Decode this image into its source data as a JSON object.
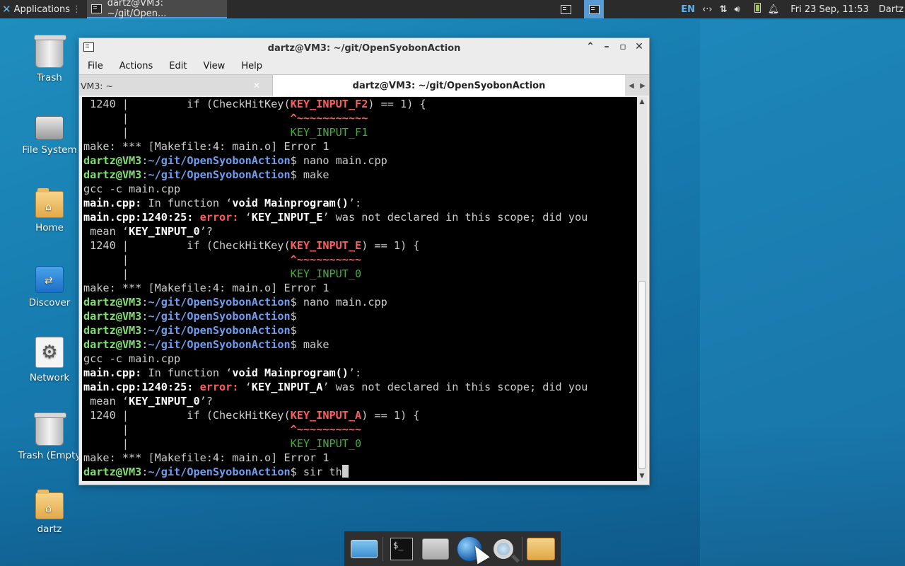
{
  "top_panel": {
    "applications_label": "Applications",
    "task_label": "dartz@VM3: ~/git/Open...",
    "keyboard_layout": "EN",
    "datetime": "Fri 23 Sep, 11:53",
    "user": "Dartz",
    "icons": [
      "network-icon",
      "transfer-icon",
      "volume-icon",
      "battery-icon",
      "bell-icon"
    ]
  },
  "desktop_icons": [
    {
      "label": "Trash",
      "icon": "trash-icon"
    },
    {
      "label": "File System",
      "icon": "drive-icon"
    },
    {
      "label": "Home",
      "icon": "home-folder-icon"
    },
    {
      "label": "Discover",
      "icon": "discover-icon"
    },
    {
      "label": "Network",
      "icon": "network-settings-icon"
    },
    {
      "label": "Trash (Empty",
      "icon": "trash-icon"
    },
    {
      "label": "dartz",
      "icon": "home-folder-icon"
    }
  ],
  "window": {
    "title": "dartz@VM3: ~/git/OpenSyobonAction",
    "menu": [
      "File",
      "Actions",
      "Edit",
      "View",
      "Help"
    ],
    "tabs": [
      {
        "label": "VM3: ~",
        "active": false
      },
      {
        "label": "dartz@VM3: ~/git/OpenSyobonAction",
        "active": true
      }
    ]
  },
  "terminal": {
    "lines": [
      [
        {
          "t": " 1240 |         if (CheckHitKey(",
          "c": ""
        },
        {
          "t": "KEY_INPUT_F2",
          "c": "r"
        },
        {
          "t": ") == 1) {",
          "c": ""
        }
      ],
      [
        {
          "t": "      |                         ",
          "c": ""
        },
        {
          "t": "^~~~~~~~~~~~",
          "c": "r"
        }
      ],
      [
        {
          "t": "      |                         ",
          "c": ""
        },
        {
          "t": "KEY_INPUT_F1",
          "c": "gr"
        }
      ],
      [
        {
          "t": "make: *** [Makefile:4: main.o] Error 1",
          "c": ""
        }
      ],
      [
        {
          "t": "dartz@VM3",
          "c": "g"
        },
        {
          "t": ":",
          "c": ""
        },
        {
          "t": "~/git/OpenSyobonAction",
          "c": "b"
        },
        {
          "t": "$ nano main.cpp",
          "c": ""
        }
      ],
      [
        {
          "t": "dartz@VM3",
          "c": "g"
        },
        {
          "t": ":",
          "c": ""
        },
        {
          "t": "~/git/OpenSyobonAction",
          "c": "b"
        },
        {
          "t": "$ make",
          "c": ""
        }
      ],
      [
        {
          "t": "gcc -c main.cpp",
          "c": ""
        }
      ],
      [
        {
          "t": "main.cpp:",
          "c": "w"
        },
        {
          "t": " In function ‘",
          "c": ""
        },
        {
          "t": "void Mainprogram()",
          "c": "w"
        },
        {
          "t": "’:",
          "c": ""
        }
      ],
      [
        {
          "t": "main.cpp:1240:25:",
          "c": "w"
        },
        {
          "t": " ",
          "c": ""
        },
        {
          "t": "error:",
          "c": "r"
        },
        {
          "t": " ‘",
          "c": ""
        },
        {
          "t": "KEY_INPUT_E",
          "c": "w"
        },
        {
          "t": "’ was not declared in this scope; did you",
          "c": ""
        }
      ],
      [
        {
          "t": " mean ‘",
          "c": ""
        },
        {
          "t": "KEY_INPUT_0",
          "c": "w"
        },
        {
          "t": "’?",
          "c": ""
        }
      ],
      [
        {
          "t": " 1240 |         if (CheckHitKey(",
          "c": ""
        },
        {
          "t": "KEY_INPUT_E",
          "c": "r"
        },
        {
          "t": ") == 1) {",
          "c": ""
        }
      ],
      [
        {
          "t": "      |                         ",
          "c": ""
        },
        {
          "t": "^~~~~~~~~~~",
          "c": "r"
        }
      ],
      [
        {
          "t": "      |                         ",
          "c": ""
        },
        {
          "t": "KEY_INPUT_0",
          "c": "gr"
        }
      ],
      [
        {
          "t": "make: *** [Makefile:4: main.o] Error 1",
          "c": ""
        }
      ],
      [
        {
          "t": "dartz@VM3",
          "c": "g"
        },
        {
          "t": ":",
          "c": ""
        },
        {
          "t": "~/git/OpenSyobonAction",
          "c": "b"
        },
        {
          "t": "$ nano main.cpp",
          "c": ""
        }
      ],
      [
        {
          "t": "dartz@VM3",
          "c": "g"
        },
        {
          "t": ":",
          "c": ""
        },
        {
          "t": "~/git/OpenSyobonAction",
          "c": "b"
        },
        {
          "t": "$",
          "c": ""
        }
      ],
      [
        {
          "t": "dartz@VM3",
          "c": "g"
        },
        {
          "t": ":",
          "c": ""
        },
        {
          "t": "~/git/OpenSyobonAction",
          "c": "b"
        },
        {
          "t": "$",
          "c": ""
        }
      ],
      [
        {
          "t": "dartz@VM3",
          "c": "g"
        },
        {
          "t": ":",
          "c": ""
        },
        {
          "t": "~/git/OpenSyobonAction",
          "c": "b"
        },
        {
          "t": "$ make",
          "c": ""
        }
      ],
      [
        {
          "t": "gcc -c main.cpp",
          "c": ""
        }
      ],
      [
        {
          "t": "main.cpp:",
          "c": "w"
        },
        {
          "t": " In function ‘",
          "c": ""
        },
        {
          "t": "void Mainprogram()",
          "c": "w"
        },
        {
          "t": "’:",
          "c": ""
        }
      ],
      [
        {
          "t": "main.cpp:1240:25:",
          "c": "w"
        },
        {
          "t": " ",
          "c": ""
        },
        {
          "t": "error:",
          "c": "r"
        },
        {
          "t": " ‘",
          "c": ""
        },
        {
          "t": "KEY_INPUT_A",
          "c": "w"
        },
        {
          "t": "’ was not declared in this scope; did you",
          "c": ""
        }
      ],
      [
        {
          "t": " mean ‘",
          "c": ""
        },
        {
          "t": "KEY_INPUT_0",
          "c": "w"
        },
        {
          "t": "’?",
          "c": ""
        }
      ],
      [
        {
          "t": " 1240 |         if (CheckHitKey(",
          "c": ""
        },
        {
          "t": "KEY_INPUT_A",
          "c": "r"
        },
        {
          "t": ") == 1) {",
          "c": ""
        }
      ],
      [
        {
          "t": "      |                         ",
          "c": ""
        },
        {
          "t": "^~~~~~~~~~~",
          "c": "r"
        }
      ],
      [
        {
          "t": "      |                         ",
          "c": ""
        },
        {
          "t": "KEY_INPUT_0",
          "c": "gr"
        }
      ],
      [
        {
          "t": "make: *** [Makefile:4: main.o] Error 1",
          "c": ""
        }
      ],
      [
        {
          "t": "dartz@VM3",
          "c": "g"
        },
        {
          "t": ":",
          "c": ""
        },
        {
          "t": "~/git/OpenSyobonAction",
          "c": "b"
        },
        {
          "t": "$ sir th",
          "c": ""
        }
      ]
    ]
  },
  "dock": {
    "items": [
      {
        "icon": "show-desktop-icon"
      },
      {
        "icon": "terminal-icon"
      },
      {
        "icon": "file-manager-icon"
      },
      {
        "icon": "web-browser-icon"
      },
      {
        "icon": "app-finder-icon"
      },
      {
        "icon": "folder-icon"
      }
    ]
  },
  "colors": {
    "prompt_user": "#7fe16f",
    "prompt_path": "#6f9df0",
    "error": "#ff5b5b",
    "suggestion": "#3fae33",
    "accent": "#5b9bd5"
  }
}
